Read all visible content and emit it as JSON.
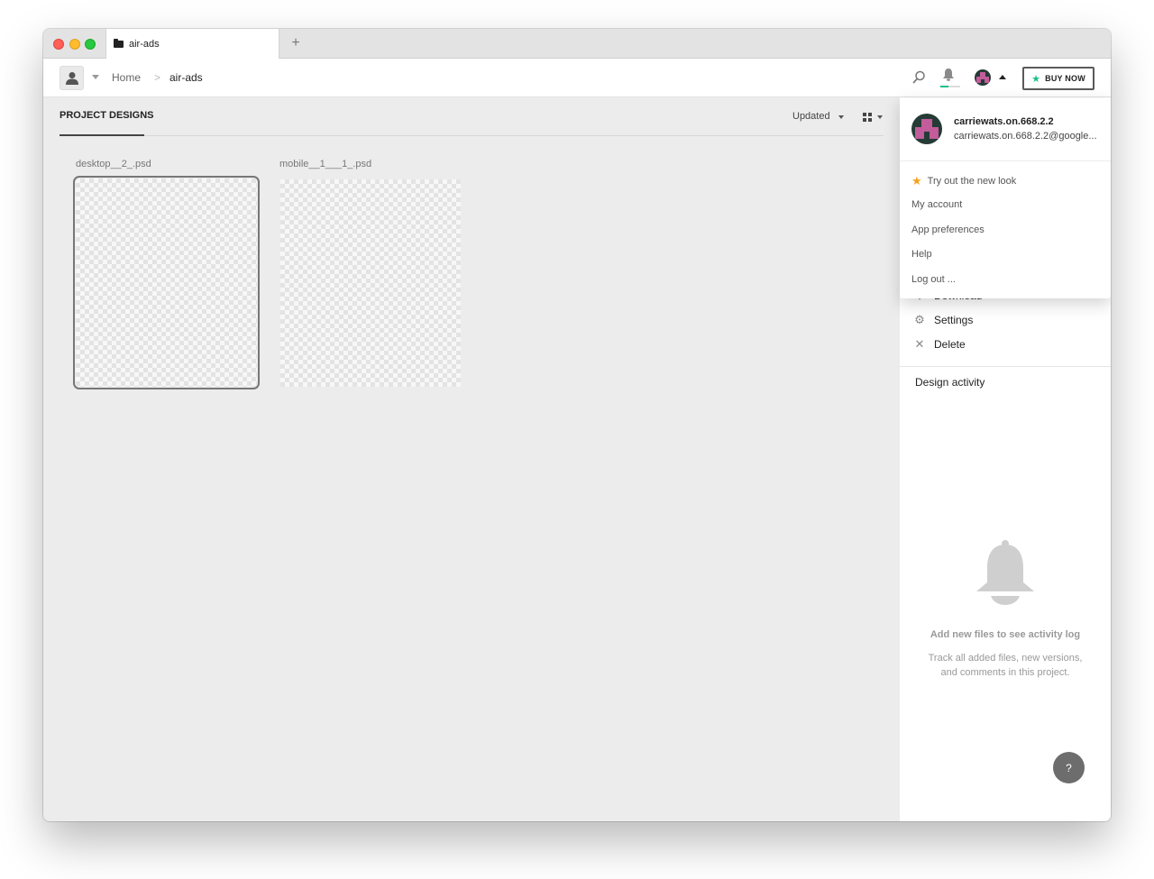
{
  "titlebar": {
    "tab_label": "air-ads",
    "new_tab_label": "+"
  },
  "header": {
    "breadcrumb": {
      "home": "Home",
      "separator": ">",
      "current": "air-ads"
    },
    "buy_label": "BUY NOW"
  },
  "main": {
    "section_tab": "PROJECT DESIGNS",
    "sort_label": "Updated",
    "designs": [
      {
        "name": "desktop__2_.psd"
      },
      {
        "name": "mobile__1___1_.psd"
      }
    ]
  },
  "panel": {
    "actions": [
      {
        "label": "Download",
        "icon": "download-icon"
      },
      {
        "label": "Settings",
        "icon": "gear-icon"
      },
      {
        "label": "Delete",
        "icon": "close-icon"
      }
    ],
    "activity_title": "Design activity",
    "empty_title": "Add new files to see activity log",
    "empty_desc": "Track all added files, new versions, and comments in this project.",
    "help_label": "?"
  },
  "dropdown": {
    "username": "carriewats.on.668.2.2",
    "email": "carriewats.on.668.2.2@google...",
    "items": [
      {
        "label": "Try out the new look",
        "icon": "star-icon"
      },
      {
        "label": "My account"
      },
      {
        "label": "App preferences"
      },
      {
        "label": "Help"
      },
      {
        "label": "Log out ..."
      }
    ]
  },
  "colors": {
    "accent_green": "#1bbf86",
    "star_orange": "#f4a11c",
    "avatar_bg": "#253b36",
    "avatar_pink": "#c25c9b"
  }
}
